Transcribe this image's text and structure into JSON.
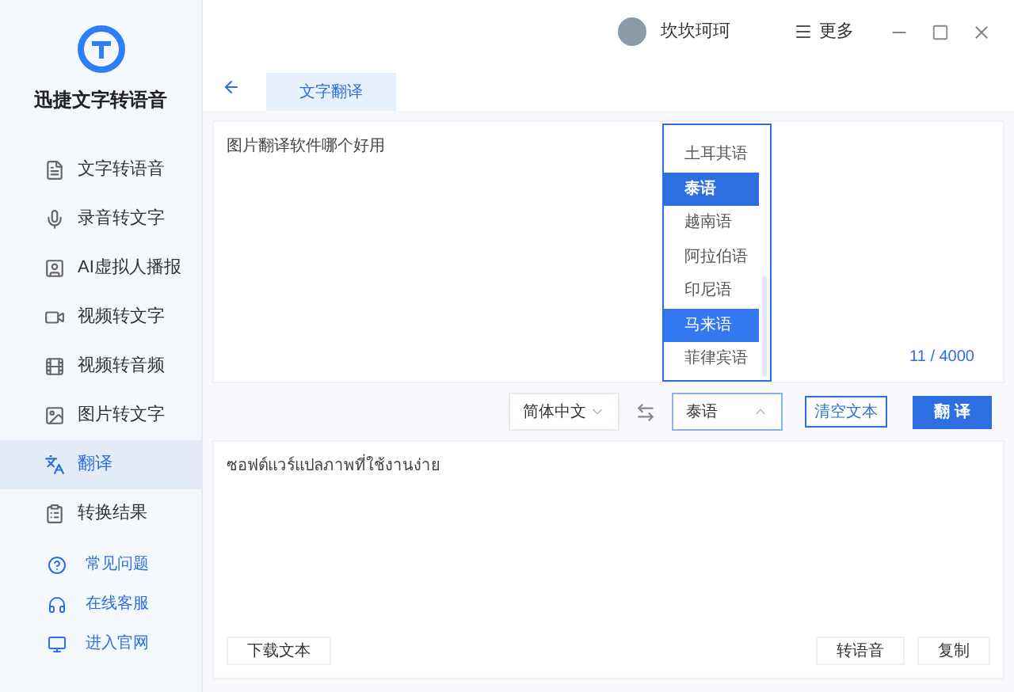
{
  "app": {
    "name": "迅捷文字转语音"
  },
  "sidebar": {
    "items": [
      {
        "label": "文字转语音",
        "selected": false
      },
      {
        "label": "录音转文字",
        "selected": false
      },
      {
        "label": "AI虚拟人播报",
        "selected": false
      },
      {
        "label": "视频转文字",
        "selected": false
      },
      {
        "label": "视频转音频",
        "selected": false
      },
      {
        "label": "图片转文字",
        "selected": false
      },
      {
        "label": "翻译",
        "selected": true
      },
      {
        "label": "转换结果",
        "selected": false
      }
    ],
    "links": [
      "常见问题",
      "在线客服",
      "进入官网"
    ]
  },
  "titlebar": {
    "user": "坎坎珂珂",
    "more": "更多"
  },
  "tabs": [
    {
      "label": "文字翻译",
      "selected": true
    }
  ],
  "source": {
    "value": "图片翻译软件哪个好用",
    "counter": "11 / 4000"
  },
  "controls": {
    "from": "简体中文",
    "to": "泰语",
    "to_open": true,
    "clear": "清空文本",
    "translate": "翻 译"
  },
  "dropdown": {
    "options": [
      {
        "label": "土耳其语",
        "selected": false,
        "hovered": false
      },
      {
        "label": "泰语",
        "selected": true,
        "hovered": false
      },
      {
        "label": "越南语",
        "selected": false,
        "hovered": false
      },
      {
        "label": "阿拉伯语",
        "selected": false,
        "hovered": false
      },
      {
        "label": "印尼语",
        "selected": false,
        "hovered": false
      },
      {
        "label": "马来语",
        "selected": false,
        "hovered": true
      },
      {
        "label": "菲律宾语",
        "selected": false,
        "hovered": false
      }
    ]
  },
  "output": {
    "text": "ซอฟต์แวร์แปลภาพที่ใช้งานง่าย",
    "buttons": [
      "下载文本",
      "转语音",
      "复制"
    ]
  }
}
